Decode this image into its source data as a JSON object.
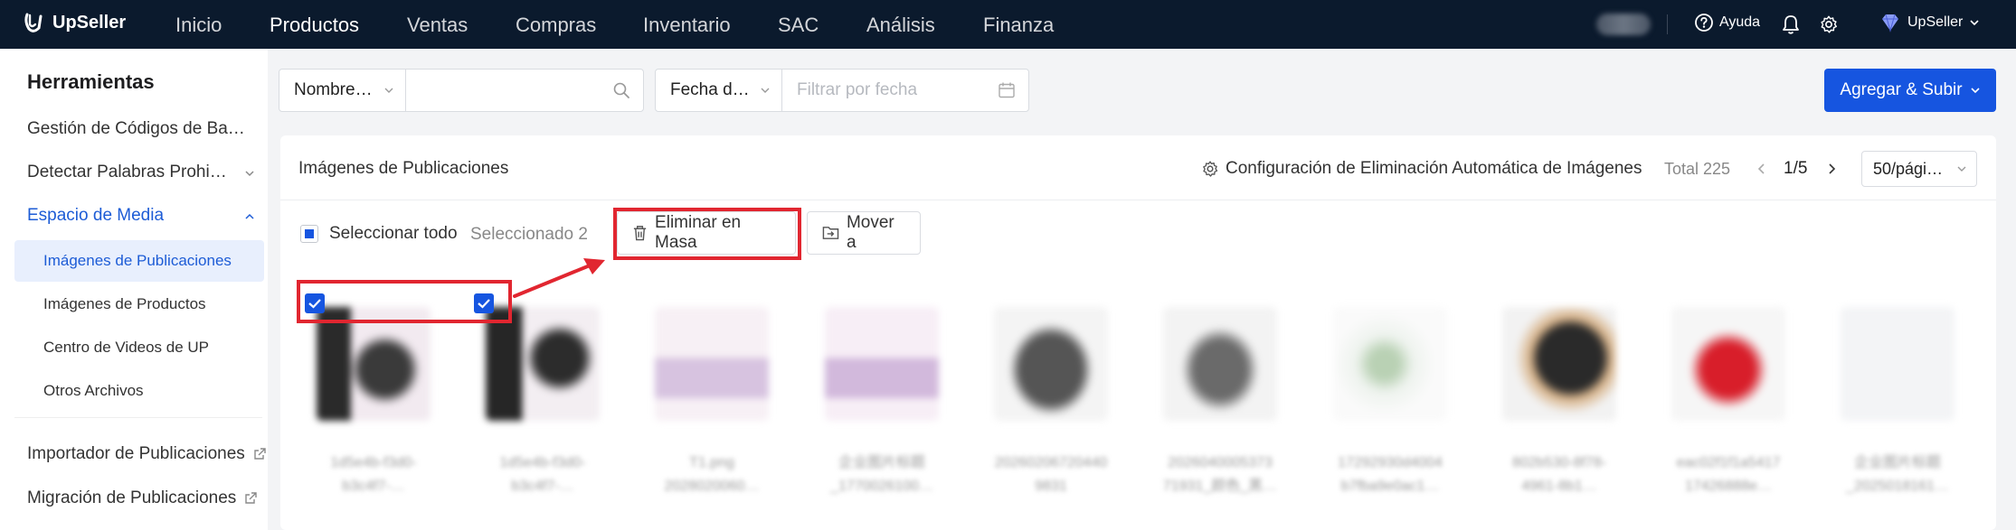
{
  "app": {
    "brand": "UpSeller"
  },
  "topnav": {
    "items": [
      "Inicio",
      "Productos",
      "Ventas",
      "Compras",
      "Inventario",
      "SAC",
      "Análisis",
      "Finanza"
    ],
    "help_label": "Ayuda",
    "user_label": "UpSeller"
  },
  "sidebar": {
    "title": "Herramientas",
    "items": [
      "Gestión de Códigos de Ba…",
      "Detectar Palabras Prohi…",
      "Espacio de Media",
      "Importador de Publicaciones",
      "Migración de Publicaciones"
    ],
    "subitems": [
      "Imágenes de Publicaciones",
      "Imágenes de Productos",
      "Centro de Videos de UP",
      "Otros Archivos"
    ]
  },
  "filters": {
    "name_select": "Nombre…",
    "name_input_value": "",
    "date_select": "Fecha d…",
    "date_placeholder": "Filtrar por fecha"
  },
  "actions": {
    "add_upload": "Agregar & Subir"
  },
  "panel": {
    "title": "Imágenes de Publicaciones",
    "config_link": "Configuración de Eliminación Automática de Imágenes",
    "total": "Total 225",
    "page": "1/5",
    "page_size": "50/pági…"
  },
  "toolbar": {
    "select_all": "Seleccionar todo",
    "selected": "Seleccionado 2",
    "bulk_delete": "Eliminar en Masa",
    "move_to": "Mover a"
  },
  "images": [
    {
      "caption1": "1d5e4b-f3d0-",
      "caption2": "b3c4f7-…",
      "checked": true
    },
    {
      "caption1": "1d5e4b-f3d0-",
      "caption2": "b3c4f7-…",
      "checked": true
    },
    {
      "caption1": "T1.png",
      "caption2": "2028020060…",
      "checked": false
    },
    {
      "caption1": "企业图片标题",
      "caption2": "_1770026100…",
      "checked": false
    },
    {
      "caption1": "20260206720440",
      "caption2": "9831",
      "checked": false
    },
    {
      "caption1": "2026040005373",
      "caption2": "71931_颜色_黑…",
      "checked": false
    },
    {
      "caption1": "17292930d4004",
      "caption2": "b7fba9e0ac1…",
      "checked": false
    },
    {
      "caption1": "802b530-8f78-",
      "caption2": "4961-8b1…",
      "checked": false
    },
    {
      "caption1": "eac02f1f1a5417",
      "caption2": "17426888e…",
      "checked": false
    },
    {
      "caption1": "企业图片标题",
      "caption2": "_2025018161…",
      "checked": false
    }
  ],
  "colors": {
    "topbar": "#0b1a2d",
    "primary": "#1655e0",
    "annotation": "#e12630"
  }
}
